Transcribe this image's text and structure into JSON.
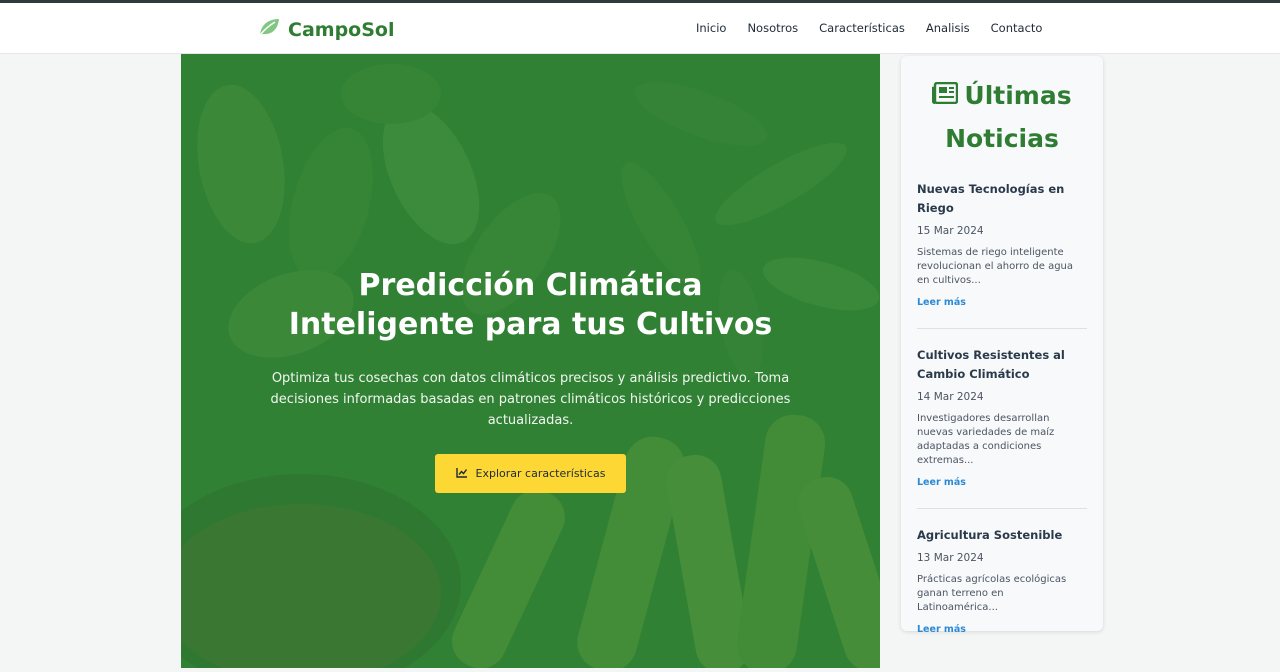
{
  "brand": {
    "name": "CampoSol",
    "icon": "leaf-icon",
    "color": "#2e7d32"
  },
  "nav": {
    "items": [
      {
        "label": "Inicio"
      },
      {
        "label": "Nosotros"
      },
      {
        "label": "Características"
      },
      {
        "label": "Analisis"
      },
      {
        "label": "Contacto"
      }
    ]
  },
  "hero": {
    "title": "Predicción Climática Inteligente para tus Cultivos",
    "subtitle": "Optimiza tus cosechas con datos climáticos precisos y análisis predictivo. Toma decisiones informadas basadas en patrones climáticos históricos y predicciones actualizadas.",
    "button_label": "Explorar características",
    "button_icon": "chart-line-icon",
    "button_color": "#fdd835",
    "overlay_color": "#2e7d32"
  },
  "news": {
    "heading_line1": "Últimas",
    "heading_line2": "Noticias",
    "heading_icon": "newspaper-icon",
    "items": [
      {
        "title": "Nuevas Tecnologías en Riego",
        "date": "15 Mar 2024",
        "summary": "Sistemas de riego inteligente revolucionan el ahorro de agua en cultivos...",
        "link": "Leer más"
      },
      {
        "title": "Cultivos Resistentes al Cambio Climático",
        "date": "14 Mar 2024",
        "summary": "Investigadores desarrollan nuevas variedades de maíz adaptadas a condiciones extremas...",
        "link": "Leer más"
      },
      {
        "title": "Agricultura Sostenible",
        "date": "13 Mar 2024",
        "summary": "Prácticas agrícolas ecológicas ganan terreno en Latinoamérica...",
        "link": "Leer más"
      }
    ]
  }
}
